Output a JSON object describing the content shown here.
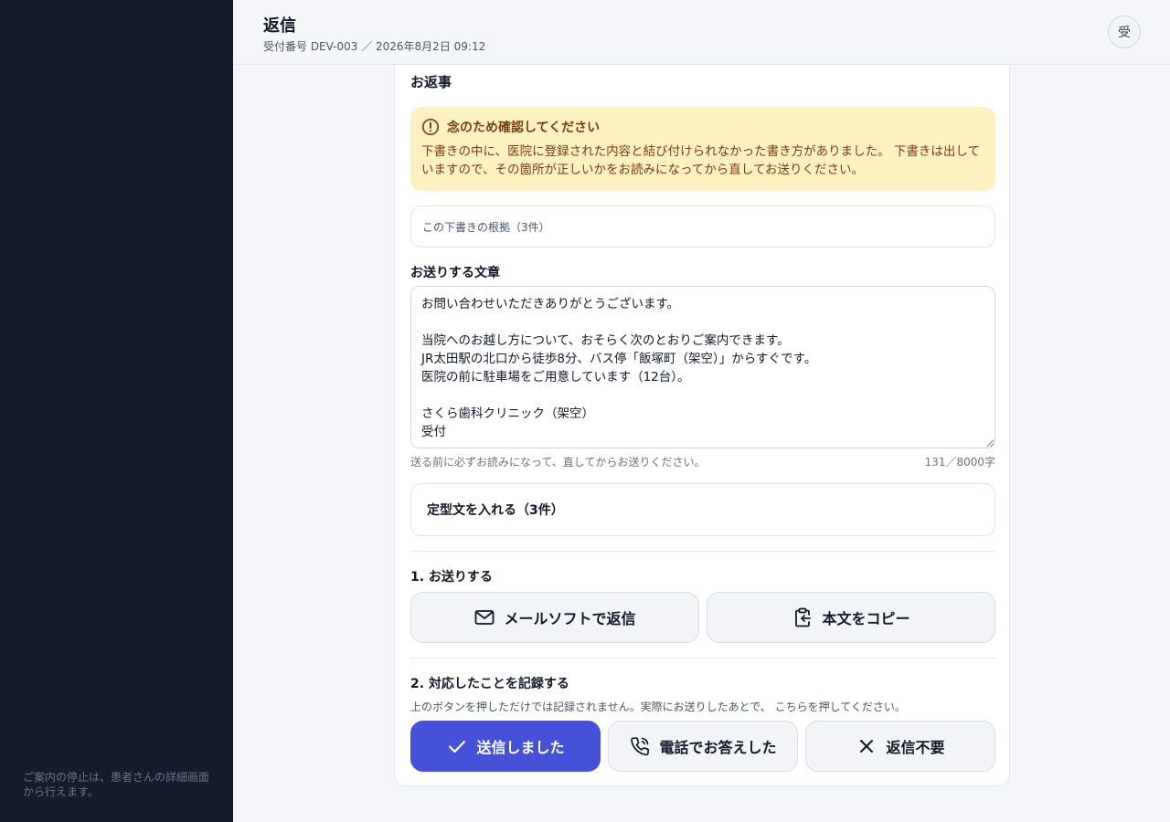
{
  "sidebar": {
    "note": "ご案内の停止は、患者さんの詳細画面から行えます。"
  },
  "header": {
    "title": "返信",
    "subtitle": "受付番号 DEV-003 ／ 2026年8月2日 09:12",
    "avatar": "受"
  },
  "card": {
    "title": "お返事",
    "warning": {
      "title": "念のため確認してください",
      "body": "下書きの中に、医院に登録された内容と結び付けられなかった書き方がありました。 下書きは出していますので、その箇所が正しいかをお読みになってから直してお送りください。"
    },
    "basis_label": "この下書きの根拠（3件）",
    "reply_label": "お送りする文章",
    "reply_text": "お問い合わせいただきありがとうございます。\n\n当院へのお越し方について、おそらく次のとおりご案内できます。\nJR太田駅の北口から徒歩8分、バス停「飯塚町（架空）」からすぐです。\n医院の前に駐車場をご用意しています（12台）。\n\nさくら歯科クリニック（架空）\n受付",
    "reply_hint": "送る前に必ずお読みになって、直してからお送りください。",
    "char_count": "131／8000字",
    "templates_label": "定型文を入れる（3件）",
    "step1_title": "1. お送りする",
    "mail_button": "メールソフトで返信",
    "copy_button": "本文をコピー",
    "step2_title": "2. 対応したことを記録する",
    "step2_note": "上のボタンを押しただけでは記録されません。実際にお送りしたあとで、 こちらを押してください。",
    "sent_button": "送信しました",
    "phone_button": "電話でお答えした",
    "no_reply_button": "返信不要"
  },
  "colors": {
    "sidebar": "#141b2d",
    "accent": "#4552d8",
    "warning_bg": "#fdf1c2",
    "warning_text": "#7a3d0c"
  }
}
